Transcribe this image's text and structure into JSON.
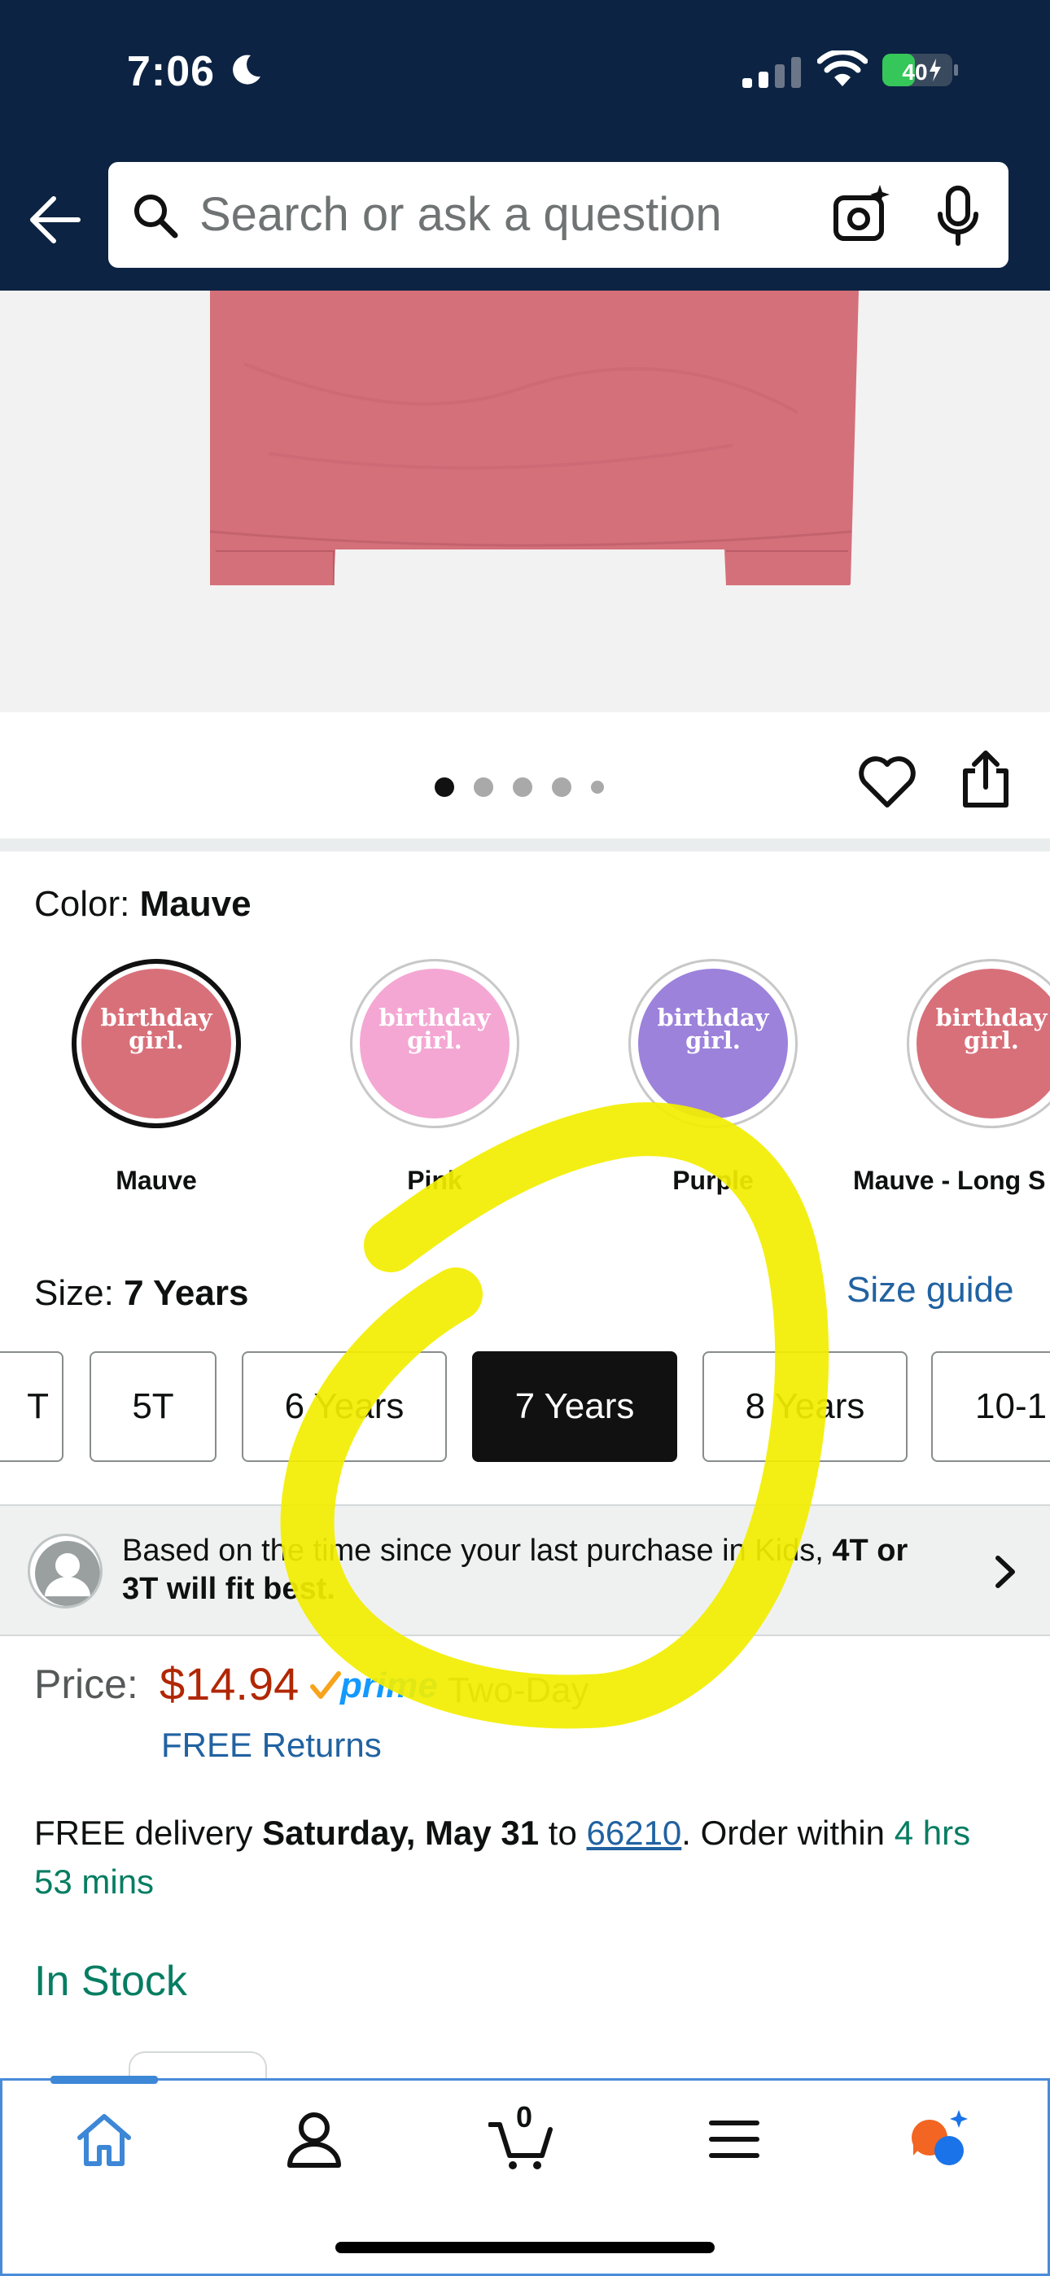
{
  "status_bar": {
    "time": "7:06",
    "battery": "40"
  },
  "search": {
    "placeholder": "Search or ask a question"
  },
  "gallery": {
    "dots_total": 5,
    "active_index": 0
  },
  "color": {
    "label": "Color:",
    "selected": "Mauve",
    "swatch_text_line1": "birthday",
    "swatch_text_line2": "girl.",
    "options": [
      {
        "name": "Mauve",
        "hex": "#d8707a"
      },
      {
        "name": "Pink",
        "hex": "#f4a7d3"
      },
      {
        "name": "Purple",
        "hex": "#9c82db"
      },
      {
        "name": "Mauve - Long S",
        "hex": "#d8707a"
      }
    ]
  },
  "size": {
    "label": "Size:",
    "selected": "7 Years",
    "guide": "Size guide",
    "options": [
      "T",
      "5T",
      "6 Years",
      "7 Years",
      "8 Years",
      "10-1"
    ]
  },
  "fit_banner": {
    "text_regular": "Based on the time since your last purchase in Kids, ",
    "text_bold": "4T or 3T will fit best."
  },
  "price": {
    "label": "Price:",
    "value": "$14.94",
    "prime": "prime",
    "shipping": "Two-Day",
    "returns": "FREE Returns"
  },
  "delivery": {
    "prefix": "FREE delivery ",
    "date": "Saturday, May 31",
    "to": " to ",
    "zip": "66210",
    "order_prefix": ". Order within ",
    "order_time": "4 hrs 53 mins"
  },
  "stock": "In Stock",
  "cart": {
    "count": "0"
  },
  "colors": {
    "header_bg": "#0c2343",
    "price_red": "#b12704",
    "link_blue": "#2162a1",
    "stock_green": "#067d62",
    "prime_blue": "#1399ff",
    "annotation_yellow": "#f2ee00"
  }
}
